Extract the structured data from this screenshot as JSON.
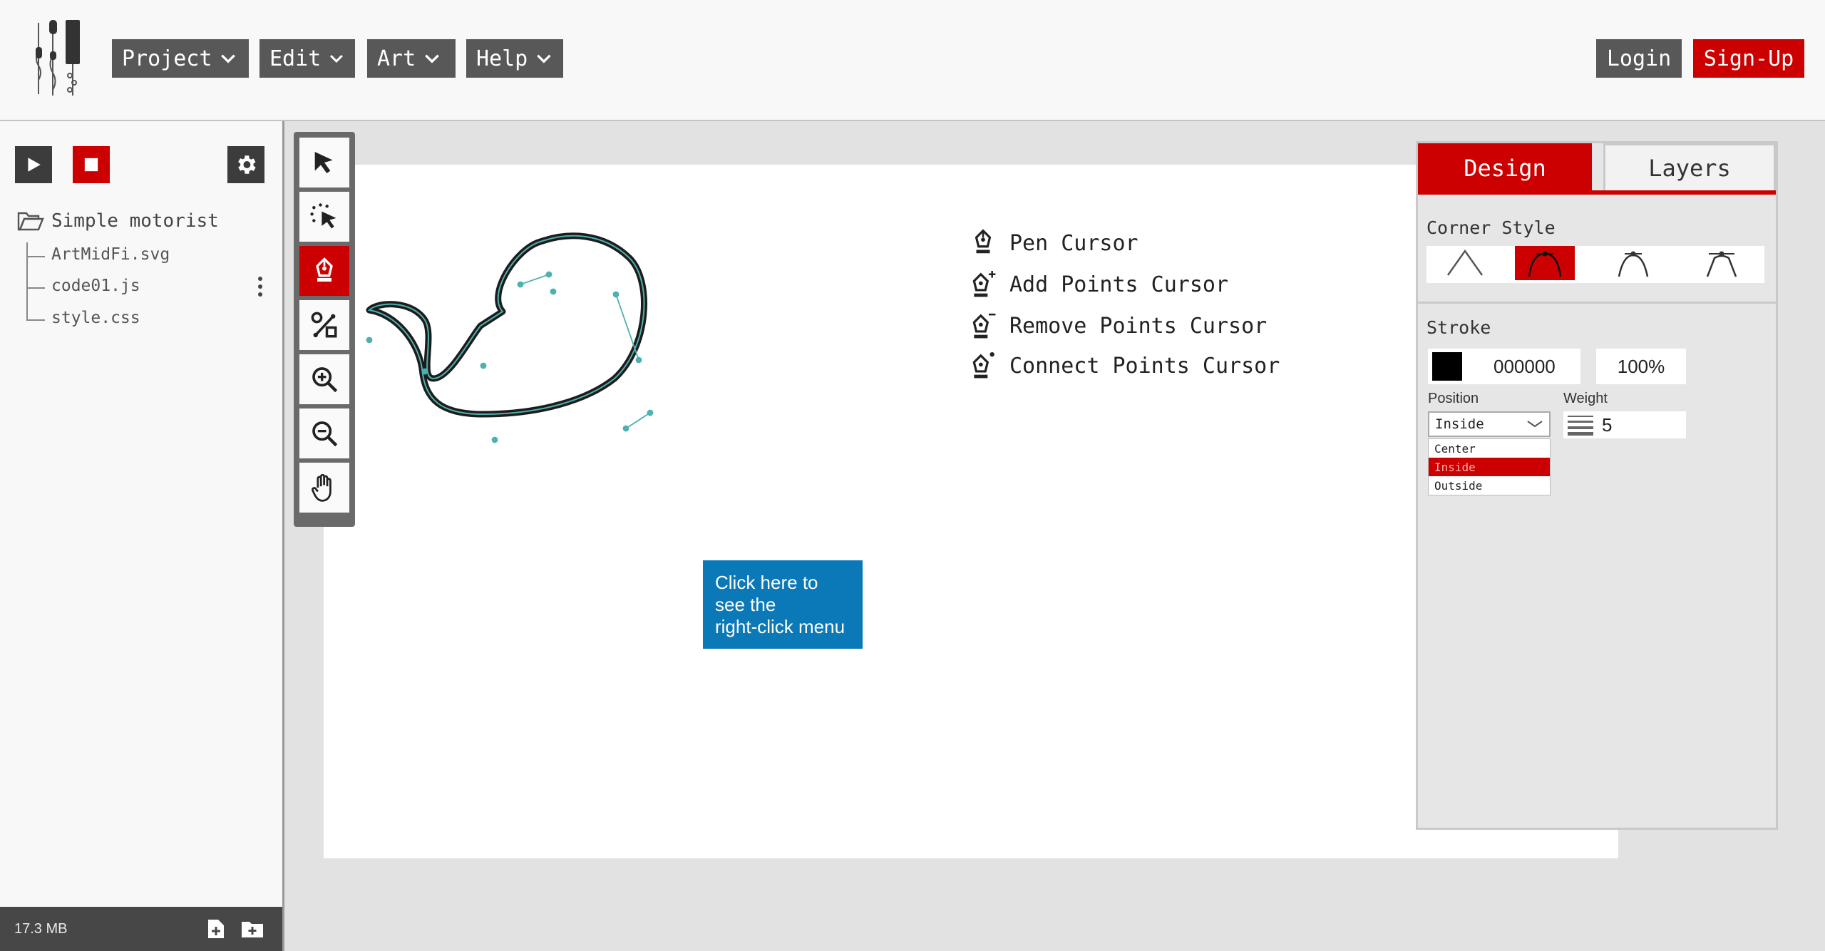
{
  "header": {
    "menus": [
      {
        "label": "Project"
      },
      {
        "label": "Edit"
      },
      {
        "label": "Art"
      },
      {
        "label": "Help"
      }
    ],
    "login_label": "Login",
    "signup_label": "Sign-Up"
  },
  "sidebar": {
    "project_name": "Simple motorist",
    "files": [
      "ArtMidFi.svg",
      "code01.js",
      "style.css"
    ],
    "storage": "17.3 MB"
  },
  "legend": [
    {
      "label": "Pen Cursor",
      "icon": "pen-icon"
    },
    {
      "label": "Add Points Cursor",
      "icon": "pen-add-icon"
    },
    {
      "label": "Remove Points Cursor",
      "icon": "pen-remove-icon"
    },
    {
      "label": "Connect Points Cursor",
      "icon": "pen-connect-icon"
    }
  ],
  "tooltip": {
    "line1": "Click here to",
    "line2": "see the",
    "line3": "right-click menu"
  },
  "panel": {
    "tabs": [
      {
        "label": "Design"
      },
      {
        "label": "Layers"
      }
    ],
    "corner_style_label": "Corner Style",
    "stroke_label": "Stroke",
    "stroke_color_hex": "000000",
    "stroke_opacity": "100%",
    "position_label": "Position",
    "position_value": "Inside",
    "position_options": [
      "Center",
      "Inside",
      "Outside"
    ],
    "weight_label": "Weight",
    "weight_value": "5"
  },
  "colors": {
    "accent": "#cc0000",
    "menu_bg": "#585858",
    "tooltip_bg": "#0b78b8"
  }
}
